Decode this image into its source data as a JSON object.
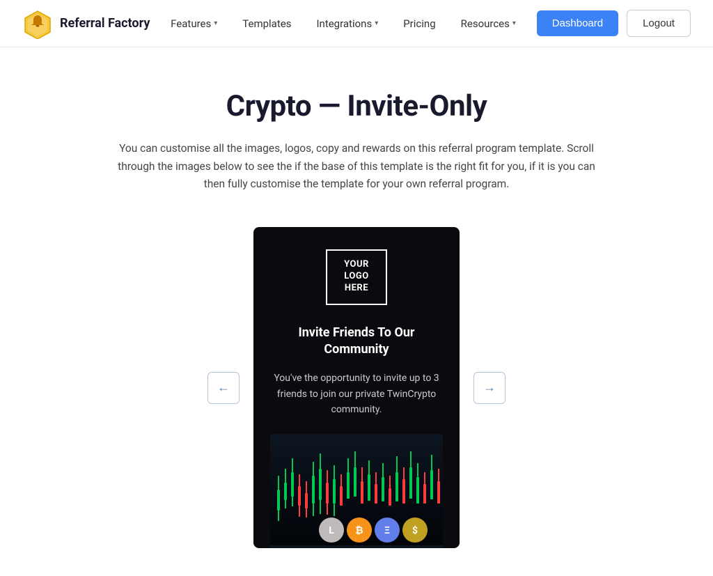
{
  "brand": {
    "name": "Referral Factory",
    "logo_alt": "Referral Factory logo"
  },
  "nav": {
    "links": [
      {
        "label": "Features",
        "has_dropdown": true
      },
      {
        "label": "Templates",
        "has_dropdown": false
      },
      {
        "label": "Integrations",
        "has_dropdown": true
      },
      {
        "label": "Pricing",
        "has_dropdown": false
      },
      {
        "label": "Resources",
        "has_dropdown": true
      }
    ],
    "dashboard_label": "Dashboard",
    "logout_label": "Logout"
  },
  "page": {
    "title": "Crypto — Invite-Only",
    "description": "You can customise all the images, logos, copy and rewards on this referral program template. Scroll through the images below to see the if the base of this template is the right fit for you, if it is you can then fully customise the template for your own referral program."
  },
  "carousel": {
    "prev_label": "←",
    "next_label": "→",
    "card": {
      "logo_line1": "YOUR",
      "logo_line2": "LOGO",
      "logo_line3": "HERE",
      "heading": "Invite Friends To Our Community",
      "body": "You've the opportunity to invite up to 3 friends to join our private TwinCrypto community."
    }
  }
}
